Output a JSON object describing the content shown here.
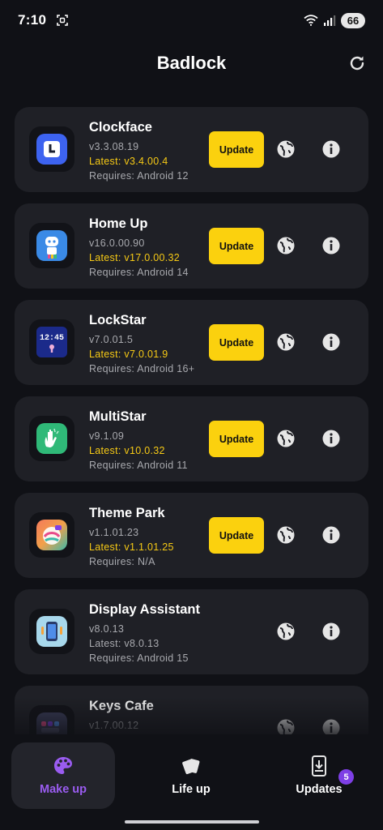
{
  "status_bar": {
    "time": "7:10",
    "battery": "66"
  },
  "header": {
    "title": "Badlock"
  },
  "apps": [
    {
      "name": "Clockface",
      "version": "v3.3.08.19",
      "latest": "Latest: v3.4.00.4",
      "requires": "Requires: Android 12",
      "update_label": "Update",
      "has_update": true,
      "icon": "clockface-icon"
    },
    {
      "name": "Home Up",
      "version": "v16.0.00.90",
      "latest": "Latest: v17.0.00.32",
      "requires": "Requires: Android 14",
      "update_label": "Update",
      "has_update": true,
      "icon": "home-up-icon"
    },
    {
      "name": "LockStar",
      "version": "v7.0.01.5",
      "latest": "Latest: v7.0.01.9",
      "requires": "Requires: Android 16+",
      "update_label": "Update",
      "has_update": true,
      "icon": "lockstar-icon",
      "icon_text": "12:45"
    },
    {
      "name": "MultiStar",
      "version": "v9.1.09",
      "latest": "Latest: v10.0.32",
      "requires": "Requires: Android 11",
      "update_label": "Update",
      "has_update": true,
      "icon": "multistar-icon"
    },
    {
      "name": "Theme Park",
      "version": "v1.1.01.23",
      "latest": "Latest: v1.1.01.25",
      "requires": "Requires: N/A",
      "update_label": "Update",
      "has_update": true,
      "icon": "theme-park-icon"
    },
    {
      "name": "Display Assistant",
      "version": "v8.0.13",
      "latest": "Latest: v8.0.13",
      "requires": "Requires: Android 15",
      "update_label": "",
      "has_update": false,
      "icon": "display-assistant-icon"
    },
    {
      "name": "Keys Cafe",
      "version": "v1.7.00.12",
      "latest": "",
      "requires": "",
      "update_label": "",
      "has_update": false,
      "icon": "keys-cafe-icon"
    }
  ],
  "bottom_nav": [
    {
      "label": "Make up",
      "icon": "palette-icon",
      "active": true
    },
    {
      "label": "Life up",
      "icon": "cards-icon",
      "active": false
    },
    {
      "label": "Updates",
      "icon": "download-phone-icon",
      "active": false,
      "badge": "5"
    }
  ],
  "colors": {
    "background": "#101116",
    "card": "#1f2026",
    "accent_yellow": "#fbd10e",
    "latest_text": "#f6c915",
    "active_nav": "#9a5cf0",
    "badge": "#7e3fe6"
  }
}
